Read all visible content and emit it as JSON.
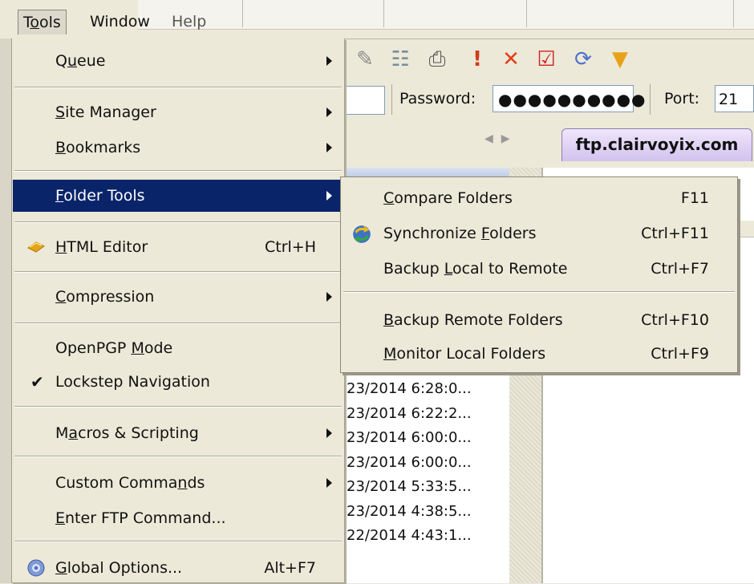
{
  "menubar": {
    "tools": "Tools",
    "tools_mnemonic": "o",
    "window": "Window",
    "help": "Help"
  },
  "toolbar": {
    "icons": [
      "edit-file-icon",
      "script-icon",
      "print-icon",
      "priority-icon",
      "delete-icon",
      "check-icon",
      "refresh-icon",
      "shield-icon"
    ]
  },
  "connection": {
    "password_label": "Password:",
    "password_value": "●●●●●●●●●●",
    "port_label": "Port:",
    "port_value": "21"
  },
  "tabs": {
    "active": "ftp.clairvoyix.com"
  },
  "list": {
    "dates": [
      "23/2014 6:28:0...",
      "23/2014 6:22:2...",
      "23/2014 6:00:0...",
      "23/2014 6:00:0...",
      "23/2014 5:33:5...",
      "23/2014 4:38:5...",
      "22/2014 4:43:1..."
    ]
  },
  "tools_menu": {
    "items": [
      {
        "pre": "Q",
        "u": "u",
        "post": "eue",
        "shortcut": "",
        "submenu": true
      },
      {
        "pre": "",
        "u": "S",
        "post": "ite Manager",
        "shortcut": "",
        "submenu": true
      },
      {
        "pre": "",
        "u": "B",
        "post": "ookmarks",
        "shortcut": "",
        "submenu": true
      },
      {
        "pre": "",
        "u": "F",
        "post": "older Tools",
        "shortcut": "",
        "submenu": true,
        "highlighted": true
      },
      {
        "pre": "",
        "u": "H",
        "post": "TML Editor",
        "shortcut": "Ctrl+H",
        "submenu": false,
        "icon": "html-editor-icon"
      },
      {
        "pre": "",
        "u": "C",
        "post": "ompression",
        "shortcut": "",
        "submenu": true
      },
      {
        "pre": "OpenPGP ",
        "u": "M",
        "post": "ode",
        "shortcut": "",
        "submenu": false
      },
      {
        "pre": "Lockstep Navigation",
        "u": "",
        "post": "",
        "shortcut": "",
        "submenu": false,
        "checked": true
      },
      {
        "pre": "M",
        "u": "a",
        "post": "cros & Scripting",
        "shortcut": "",
        "submenu": true
      },
      {
        "pre": "Custom Comma",
        "u": "n",
        "post": "ds",
        "shortcut": "",
        "submenu": true
      },
      {
        "pre": "",
        "u": "E",
        "post": "nter FTP Command...",
        "shortcut": "",
        "submenu": false
      },
      {
        "pre": "",
        "u": "G",
        "post": "lobal Options...",
        "shortcut": "Alt+F7",
        "submenu": false,
        "icon": "global-options-icon"
      }
    ],
    "check_glyph": "✔"
  },
  "folder_tools_submenu": {
    "items": [
      {
        "pre": "",
        "u": "C",
        "post": "ompare Folders",
        "shortcut": "F11"
      },
      {
        "pre": "Synchronize ",
        "u": "F",
        "post": "olders",
        "shortcut": "Ctrl+F11",
        "icon": "synchronize-icon"
      },
      {
        "pre": "Backup ",
        "u": "L",
        "post": "ocal to Remote",
        "shortcut": "Ctrl+F7"
      },
      {
        "pre": "",
        "u": "B",
        "post": "ackup Remote Folders",
        "shortcut": "Ctrl+F10"
      },
      {
        "pre": "",
        "u": "M",
        "post": "onitor Local Folders",
        "shortcut": "Ctrl+F9"
      }
    ]
  }
}
